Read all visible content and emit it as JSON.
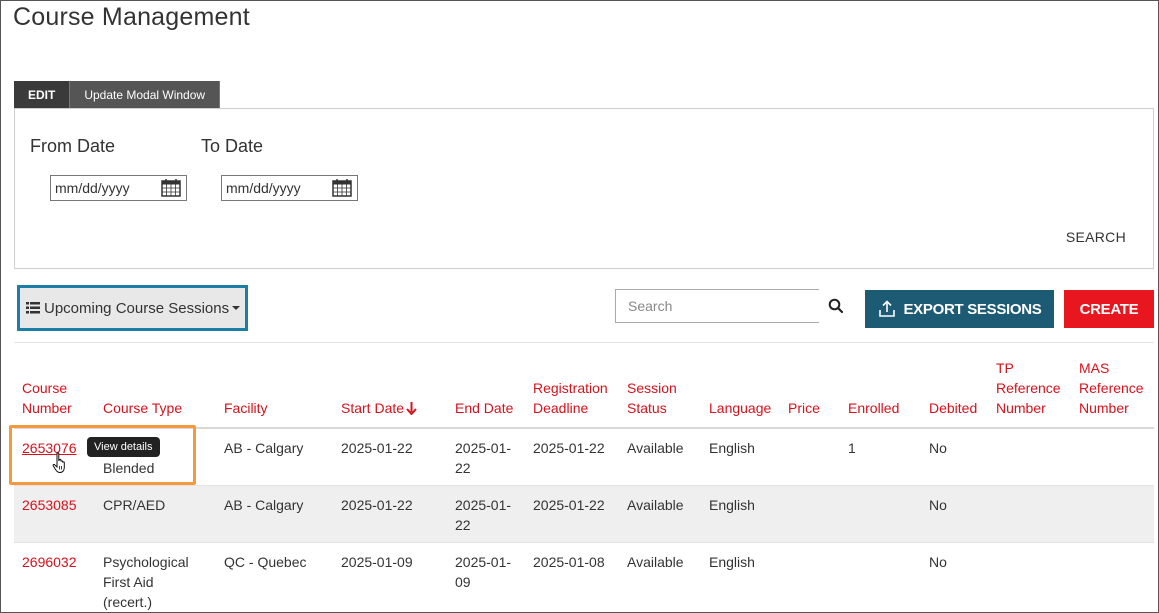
{
  "page": {
    "title": "Course Management"
  },
  "tabs": [
    {
      "label": "EDIT",
      "active": true
    },
    {
      "label": "Update Modal Window",
      "active": false
    }
  ],
  "filters": {
    "from_label": "From Date",
    "to_label": "To Date",
    "from_placeholder": "mm/dd/yyyy",
    "to_placeholder": "mm/dd/yyyy",
    "search_label": "SEARCH"
  },
  "toolbar": {
    "view_label": "Upcoming Course Sessions",
    "search_placeholder": "Search",
    "export_label": "EXPORT SESSIONS",
    "create_label": "CREATE"
  },
  "table": {
    "columns": [
      "Course\nNumber",
      "Course Type",
      "Facility",
      "Start Date",
      "End Date",
      "Registration\nDeadline",
      "Session\nStatus",
      "Language",
      "Price",
      "Enrolled",
      "Debited",
      "TP\nReference\nNumber",
      "MAS\nReference\nNumber"
    ],
    "rows": [
      {
        "course_number": "2653076",
        "course_type": "Blended",
        "facility": "AB - Calgary",
        "start_date": "2025-01-22",
        "end_date": "2025-01-\n22",
        "registration_deadline": "2025-01-22",
        "session_status": "Available",
        "language": "English",
        "price": "",
        "enrolled": "1",
        "debited": "No",
        "tp_ref": "",
        "mas_ref": ""
      },
      {
        "course_number": "2653085",
        "course_type": "CPR/AED",
        "facility": "AB - Calgary",
        "start_date": "2025-01-22",
        "end_date": "2025-01-\n22",
        "registration_deadline": "2025-01-22",
        "session_status": "Available",
        "language": "English",
        "price": "",
        "enrolled": "",
        "debited": "No",
        "tp_ref": "",
        "mas_ref": ""
      },
      {
        "course_number": "2696032",
        "course_type": "Psychological\nFirst Aid\n(recert.)",
        "facility": "QC - Quebec",
        "start_date": "2025-01-09",
        "end_date": "2025-01-\n09",
        "registration_deadline": "2025-01-08",
        "session_status": "Available",
        "language": "English",
        "price": "",
        "enrolled": "",
        "debited": "No",
        "tp_ref": "",
        "mas_ref": ""
      }
    ]
  },
  "tooltip": {
    "label": "View details"
  },
  "colors": {
    "accent_red": "#d6121c",
    "export_blue": "#1d5a73",
    "highlight_orange": "#f49a3c",
    "focus_blue": "#1a7ea6"
  },
  "icons": [
    "calendar-icon",
    "list-icon",
    "search-icon",
    "upload-icon",
    "sort-down-arrow-icon",
    "pointer-cursor-icon"
  ]
}
